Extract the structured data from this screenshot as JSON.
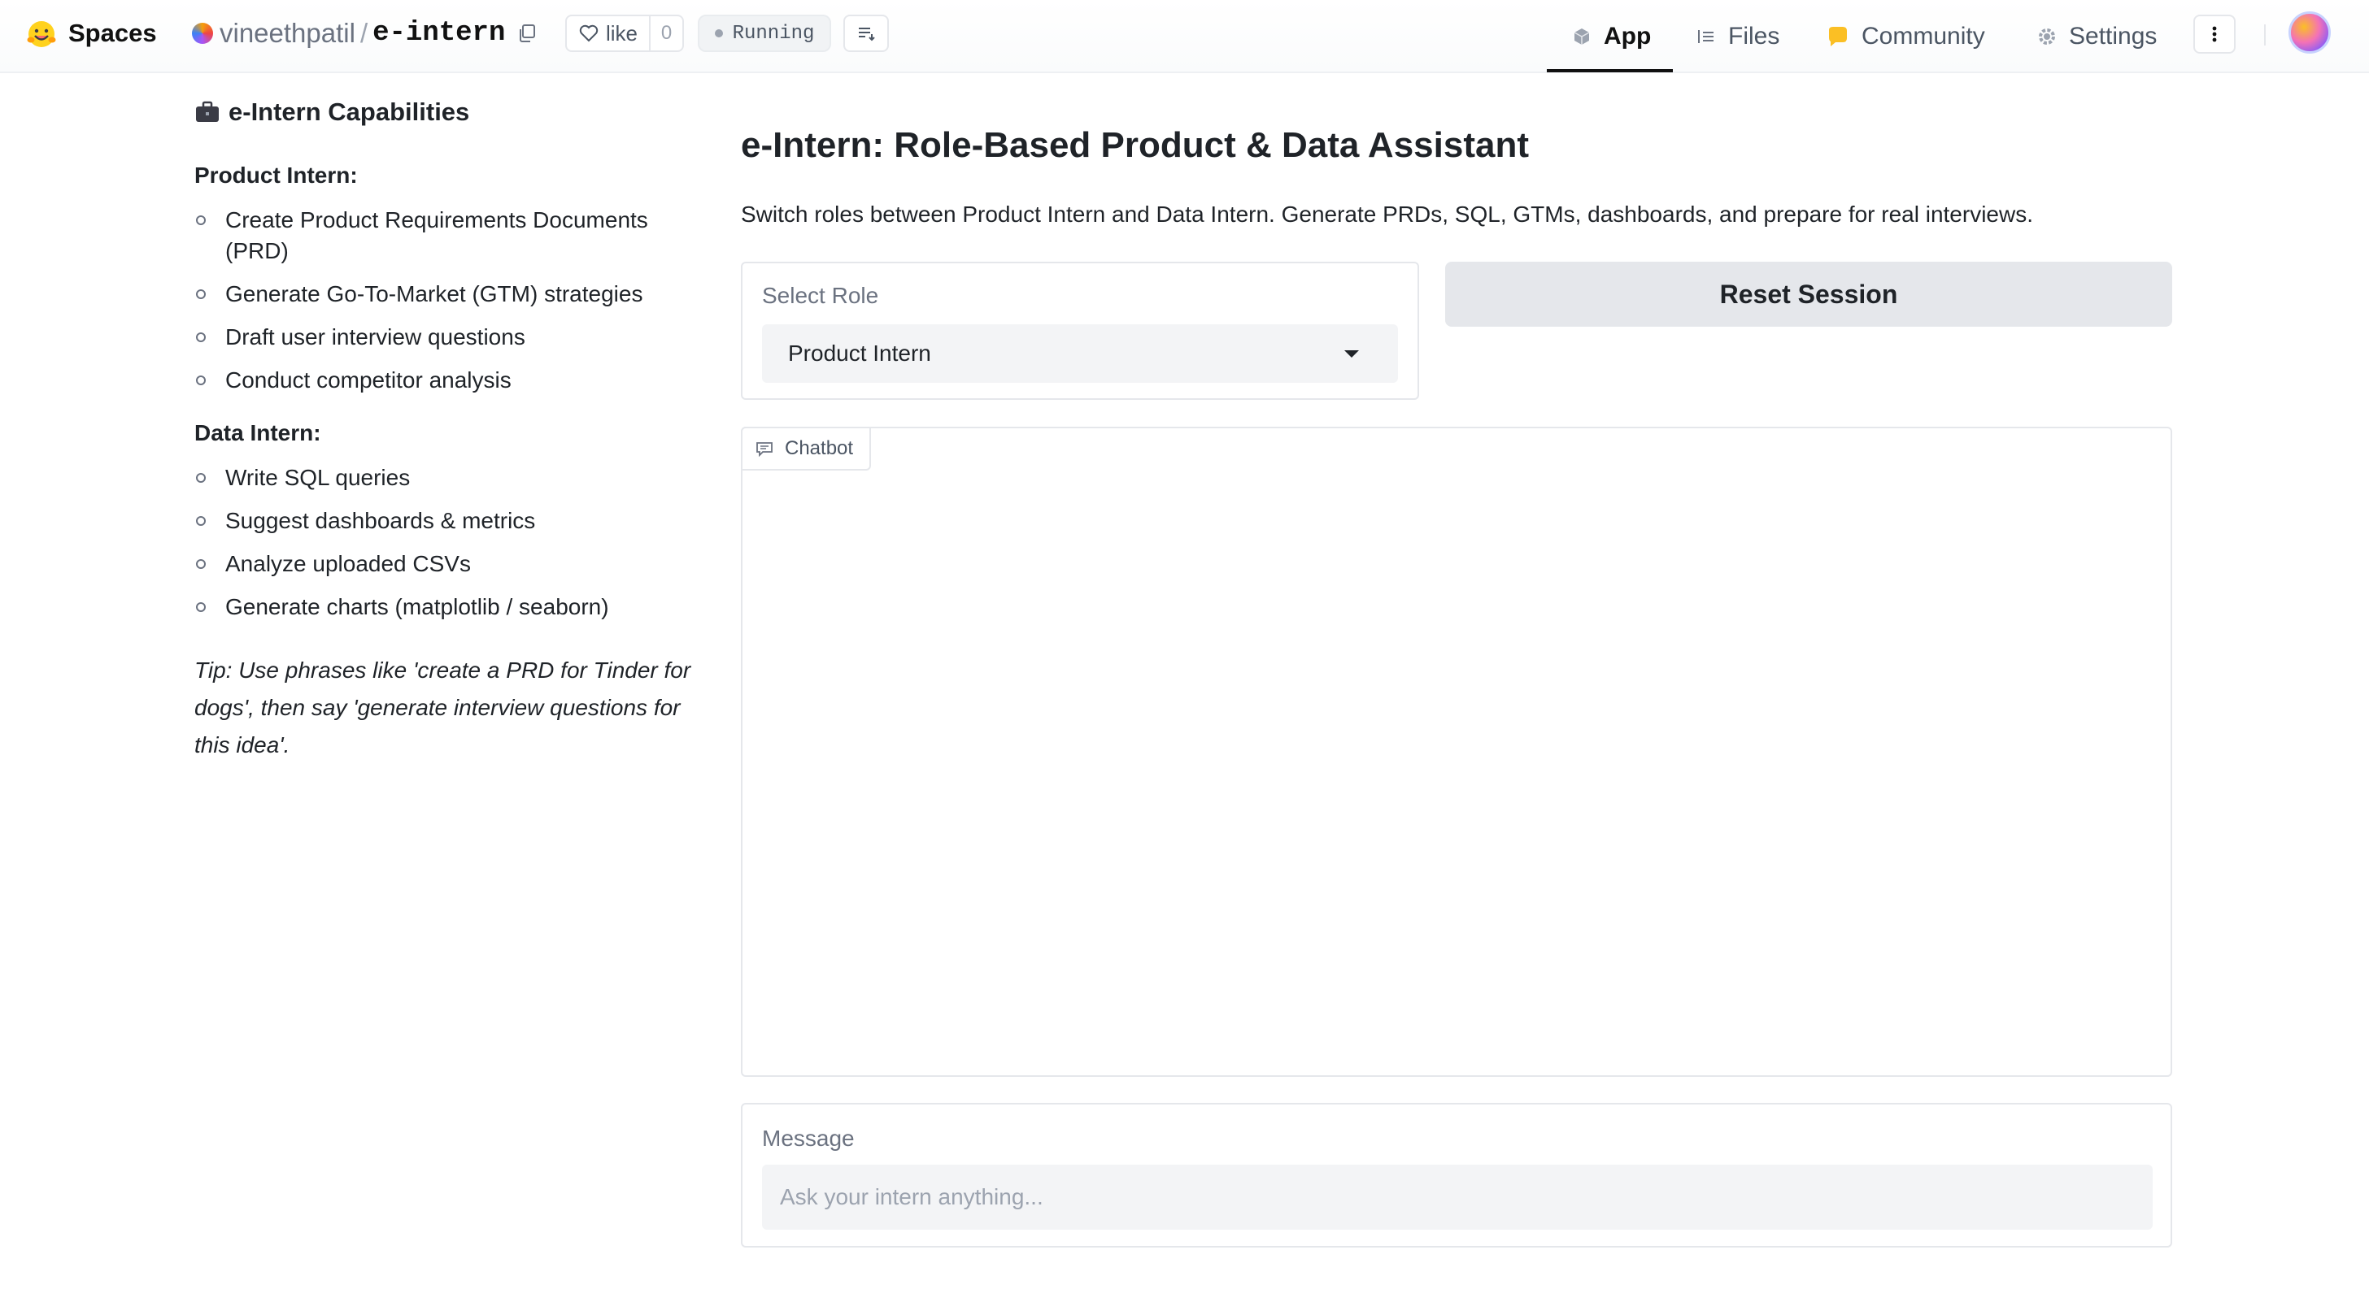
{
  "header": {
    "brand": "Spaces",
    "owner": "vineethpatil",
    "separator": "/",
    "repo": "e-intern",
    "like_label": "like",
    "like_count": "0",
    "status": "Running",
    "nav": {
      "app": "App",
      "files": "Files",
      "community": "Community",
      "settings": "Settings"
    }
  },
  "sidebar": {
    "title": "e-Intern Capabilities",
    "product_heading": "Product Intern:",
    "product_items": [
      "Create Product Requirements Documents (PRD)",
      "Generate Go-To-Market (GTM) strategies",
      "Draft user interview questions",
      "Conduct competitor analysis"
    ],
    "data_heading": "Data Intern:",
    "data_items": [
      "Write SQL queries",
      "Suggest dashboards & metrics",
      "Analyze uploaded CSVs",
      "Generate charts (matplotlib / seaborn)"
    ],
    "tip": "Tip: Use phrases like 'create a PRD for Tinder for dogs', then say 'generate interview questions for this idea'."
  },
  "main": {
    "title": "e-Intern: Role-Based Product & Data Assistant",
    "description": "Switch roles between Product Intern and Data Intern. Generate PRDs, SQL, GTMs, dashboards, and prepare for real interviews.",
    "role_label": "Select Role",
    "role_value": "Product Intern",
    "reset_label": "Reset Session",
    "chatbot_label": "Chatbot",
    "message_label": "Message",
    "message_placeholder": "Ask your intern anything..."
  }
}
